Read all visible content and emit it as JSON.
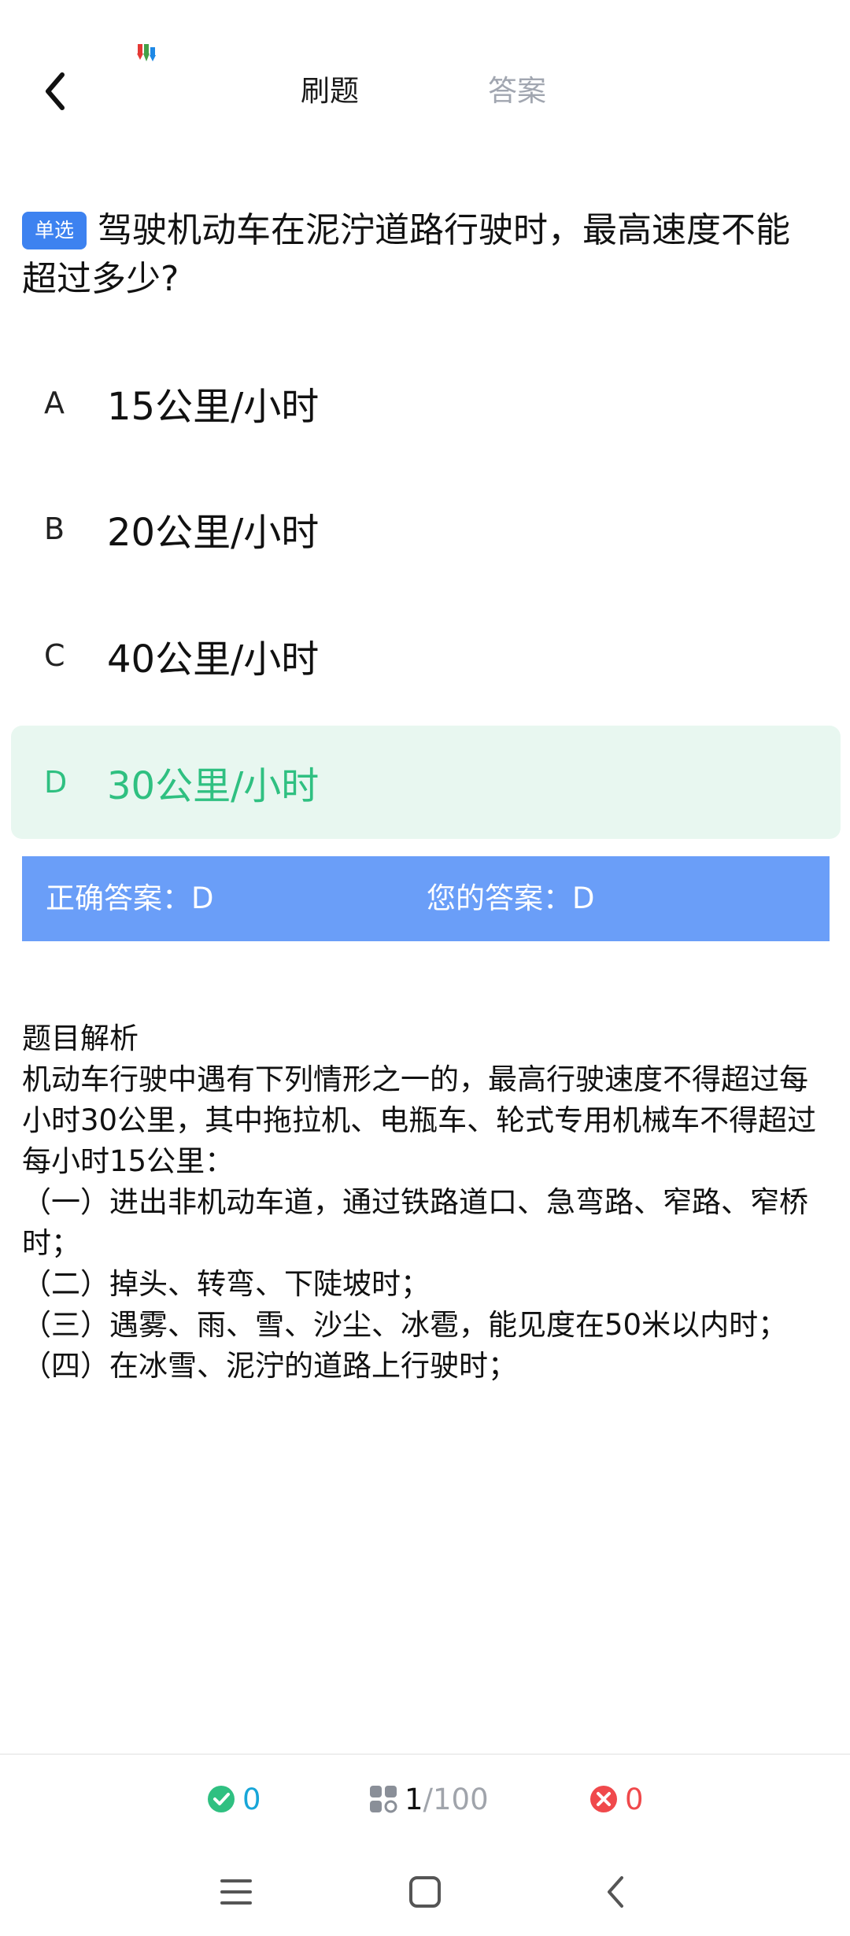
{
  "header": {
    "tabs": [
      {
        "label": "刷题",
        "active": true
      },
      {
        "label": "答案",
        "active": false
      }
    ]
  },
  "question": {
    "type_badge": "单选",
    "text": "驾驶机动车在泥泞道路行驶时，最高速度不能超过多少?"
  },
  "options": [
    {
      "letter": "A",
      "text": "15公里/小时",
      "correct": false
    },
    {
      "letter": "B",
      "text": "20公里/小时",
      "correct": false
    },
    {
      "letter": "C",
      "text": "40公里/小时",
      "correct": false
    },
    {
      "letter": "D",
      "text": "30公里/小时",
      "correct": true
    }
  ],
  "result": {
    "correct_answer": "正确答案：D",
    "your_answer": "您的答案：D"
  },
  "explanation": {
    "title": "题目解析",
    "lines": [
      "机动车行驶中遇有下列情形之一的，最高行驶速度不得超过每小时30公里，其中拖拉机、电瓶车、轮式专用机械车不得超过每小时15公里：",
      "（一）进出非机动车道，通过铁路道口、急弯路、窄路、窄桥时；",
      "（二）掉头、转弯、下陡坡时；",
      "（三）遇雾、雨、雪、沙尘、冰雹，能见度在50米以内时；",
      "（四）在冰雪、泥泞的道路上行驶时；"
    ]
  },
  "stats": {
    "correct_count": "0",
    "progress_current": "1",
    "progress_total": "/100",
    "wrong_count": "0"
  },
  "icons": {
    "back": "chevron-left-icon",
    "correct": "check-circle-icon",
    "progress": "grid-icon",
    "wrong": "x-circle-icon",
    "nav_menu": "menu-icon",
    "nav_home": "square-home-icon",
    "nav_back": "chevron-left-icon"
  },
  "colors": {
    "accent_blue": "#3d82f0",
    "result_bar": "#6a9ef8",
    "correct_green": "#2fc081",
    "correct_bg": "#e8f7f0",
    "stat_blue": "#18a6d8",
    "stat_red": "#f0494c"
  }
}
